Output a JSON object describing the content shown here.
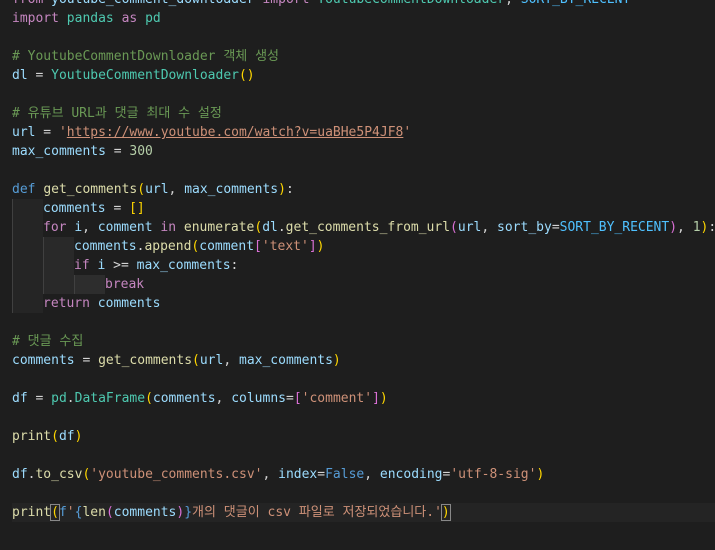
{
  "editor": {
    "colors": {
      "background": "#1e1e1e",
      "keyword": "#c586c0",
      "storage": "#569cd6",
      "function": "#dcdcaa",
      "class": "#4ec9b0",
      "variable": "#9cdcfe",
      "string": "#ce9178",
      "number": "#b5cea8",
      "constant": "#4fc1ff",
      "comment": "#6a9955"
    },
    "lines": [
      {
        "indent": 0,
        "tokens": [
          {
            "t": "from",
            "c": "kw"
          },
          {
            "t": " youtube_comment_downloader ",
            "c": "var"
          },
          {
            "t": "import",
            "c": "kw"
          },
          {
            "t": " ",
            "c": "op"
          },
          {
            "t": "YoutubeCommentDownloader",
            "c": "cls"
          },
          {
            "t": ", ",
            "c": "op"
          },
          {
            "t": "SORT_BY_RECENT",
            "c": "const"
          }
        ]
      },
      {
        "indent": 0,
        "tokens": [
          {
            "t": "import",
            "c": "kw"
          },
          {
            "t": " pandas ",
            "c": "cls"
          },
          {
            "t": "as",
            "c": "kw"
          },
          {
            "t": " pd",
            "c": "cls"
          }
        ]
      },
      {
        "indent": 0,
        "tokens": []
      },
      {
        "indent": 0,
        "tokens": [
          {
            "t": "# YoutubeCommentDownloader 객체 생성",
            "c": "cmt"
          }
        ]
      },
      {
        "indent": 0,
        "tokens": [
          {
            "t": "dl",
            "c": "var"
          },
          {
            "t": " = ",
            "c": "op"
          },
          {
            "t": "YoutubeCommentDownloader",
            "c": "cls"
          },
          {
            "t": "()",
            "c": "br1"
          }
        ]
      },
      {
        "indent": 0,
        "tokens": []
      },
      {
        "indent": 0,
        "tokens": [
          {
            "t": "# 유튜브 URL과 댓글 최대 수 설정",
            "c": "cmt"
          }
        ]
      },
      {
        "indent": 0,
        "tokens": [
          {
            "t": "url",
            "c": "var"
          },
          {
            "t": " = ",
            "c": "op"
          },
          {
            "t": "'",
            "c": "str"
          },
          {
            "t": "https://www.youtube.com/watch?v=uaBHe5P4JF8",
            "c": "str url"
          },
          {
            "t": "'",
            "c": "str"
          }
        ]
      },
      {
        "indent": 0,
        "tokens": [
          {
            "t": "max_comments",
            "c": "var"
          },
          {
            "t": " = ",
            "c": "op"
          },
          {
            "t": "300",
            "c": "num"
          }
        ]
      },
      {
        "indent": 0,
        "tokens": []
      },
      {
        "indent": 0,
        "tokens": [
          {
            "t": "def",
            "c": "def"
          },
          {
            "t": " ",
            "c": "op"
          },
          {
            "t": "get_comments",
            "c": "fn"
          },
          {
            "t": "(",
            "c": "br1"
          },
          {
            "t": "url",
            "c": "var"
          },
          {
            "t": ", ",
            "c": "op"
          },
          {
            "t": "max_comments",
            "c": "var"
          },
          {
            "t": ")",
            "c": "br1"
          },
          {
            "t": ":",
            "c": "op"
          }
        ]
      },
      {
        "indent": 1,
        "tokens": [
          {
            "t": "comments",
            "c": "var"
          },
          {
            "t": " = ",
            "c": "op"
          },
          {
            "t": "[]",
            "c": "br1"
          }
        ]
      },
      {
        "indent": 1,
        "tokens": [
          {
            "t": "for",
            "c": "kw"
          },
          {
            "t": " ",
            "c": "op"
          },
          {
            "t": "i",
            "c": "var"
          },
          {
            "t": ", ",
            "c": "op"
          },
          {
            "t": "comment",
            "c": "var"
          },
          {
            "t": " ",
            "c": "op"
          },
          {
            "t": "in",
            "c": "kw"
          },
          {
            "t": " ",
            "c": "op"
          },
          {
            "t": "enumerate",
            "c": "fn"
          },
          {
            "t": "(",
            "c": "br1"
          },
          {
            "t": "dl",
            "c": "var"
          },
          {
            "t": ".",
            "c": "op"
          },
          {
            "t": "get_comments_from_url",
            "c": "fn"
          },
          {
            "t": "(",
            "c": "br2"
          },
          {
            "t": "url",
            "c": "var"
          },
          {
            "t": ", ",
            "c": "op"
          },
          {
            "t": "sort_by",
            "c": "var"
          },
          {
            "t": "=",
            "c": "op"
          },
          {
            "t": "SORT_BY_RECENT",
            "c": "const"
          },
          {
            "t": ")",
            "c": "br2"
          },
          {
            "t": ", ",
            "c": "op"
          },
          {
            "t": "1",
            "c": "num"
          },
          {
            "t": ")",
            "c": "br1"
          },
          {
            "t": ":",
            "c": "op"
          }
        ]
      },
      {
        "indent": 2,
        "tokens": [
          {
            "t": "comments",
            "c": "var"
          },
          {
            "t": ".",
            "c": "op"
          },
          {
            "t": "append",
            "c": "fn"
          },
          {
            "t": "(",
            "c": "br1"
          },
          {
            "t": "comment",
            "c": "var"
          },
          {
            "t": "[",
            "c": "br2"
          },
          {
            "t": "'text'",
            "c": "str"
          },
          {
            "t": "]",
            "c": "br2"
          },
          {
            "t": ")",
            "c": "br1"
          }
        ]
      },
      {
        "indent": 2,
        "tokens": [
          {
            "t": "if",
            "c": "kw"
          },
          {
            "t": " ",
            "c": "op"
          },
          {
            "t": "i",
            "c": "var"
          },
          {
            "t": " >= ",
            "c": "op"
          },
          {
            "t": "max_comments",
            "c": "var"
          },
          {
            "t": ":",
            "c": "op"
          }
        ]
      },
      {
        "indent": 3,
        "tokens": [
          {
            "t": "break",
            "c": "kw"
          }
        ]
      },
      {
        "indent": 1,
        "tokens": [
          {
            "t": "return",
            "c": "kw"
          },
          {
            "t": " ",
            "c": "op"
          },
          {
            "t": "comments",
            "c": "var"
          }
        ]
      },
      {
        "indent": 0,
        "tokens": []
      },
      {
        "indent": 0,
        "tokens": [
          {
            "t": "# 댓글 수집",
            "c": "cmt"
          }
        ]
      },
      {
        "indent": 0,
        "tokens": [
          {
            "t": "comments",
            "c": "var"
          },
          {
            "t": " = ",
            "c": "op"
          },
          {
            "t": "get_comments",
            "c": "fn"
          },
          {
            "t": "(",
            "c": "br1"
          },
          {
            "t": "url",
            "c": "var"
          },
          {
            "t": ", ",
            "c": "op"
          },
          {
            "t": "max_comments",
            "c": "var"
          },
          {
            "t": ")",
            "c": "br1"
          }
        ]
      },
      {
        "indent": 0,
        "tokens": []
      },
      {
        "indent": 0,
        "tokens": [
          {
            "t": "df",
            "c": "var"
          },
          {
            "t": " = ",
            "c": "op"
          },
          {
            "t": "pd",
            "c": "cls"
          },
          {
            "t": ".",
            "c": "op"
          },
          {
            "t": "DataFrame",
            "c": "cls"
          },
          {
            "t": "(",
            "c": "br1"
          },
          {
            "t": "comments",
            "c": "var"
          },
          {
            "t": ", ",
            "c": "op"
          },
          {
            "t": "columns",
            "c": "var"
          },
          {
            "t": "=",
            "c": "op"
          },
          {
            "t": "[",
            "c": "br2"
          },
          {
            "t": "'comment'",
            "c": "str"
          },
          {
            "t": "]",
            "c": "br2"
          },
          {
            "t": ")",
            "c": "br1"
          }
        ]
      },
      {
        "indent": 0,
        "tokens": []
      },
      {
        "indent": 0,
        "tokens": [
          {
            "t": "print",
            "c": "fn"
          },
          {
            "t": "(",
            "c": "br1"
          },
          {
            "t": "df",
            "c": "var"
          },
          {
            "t": ")",
            "c": "br1"
          }
        ]
      },
      {
        "indent": 0,
        "tokens": []
      },
      {
        "indent": 0,
        "tokens": [
          {
            "t": "df",
            "c": "var"
          },
          {
            "t": ".",
            "c": "op"
          },
          {
            "t": "to_csv",
            "c": "fn"
          },
          {
            "t": "(",
            "c": "br1"
          },
          {
            "t": "'youtube_comments.csv'",
            "c": "str"
          },
          {
            "t": ", ",
            "c": "op"
          },
          {
            "t": "index",
            "c": "var"
          },
          {
            "t": "=",
            "c": "op"
          },
          {
            "t": "False",
            "c": "bool"
          },
          {
            "t": ", ",
            "c": "op"
          },
          {
            "t": "encoding",
            "c": "var"
          },
          {
            "t": "=",
            "c": "op"
          },
          {
            "t": "'utf-8-sig'",
            "c": "str"
          },
          {
            "t": ")",
            "c": "br1"
          }
        ]
      },
      {
        "indent": 0,
        "tokens": []
      },
      {
        "indent": 0,
        "cursor": true,
        "tokens": [
          {
            "t": "print",
            "c": "fn"
          },
          {
            "t": "(",
            "c": "br1 match"
          },
          {
            "t": "f",
            "c": "def"
          },
          {
            "t": "'",
            "c": "str"
          },
          {
            "t": "{",
            "c": "def"
          },
          {
            "t": "len",
            "c": "fn"
          },
          {
            "t": "(",
            "c": "br2"
          },
          {
            "t": "comments",
            "c": "var"
          },
          {
            "t": ")",
            "c": "br2"
          },
          {
            "t": "}",
            "c": "def"
          },
          {
            "t": "개의 댓글이 csv 파일로 저장되었습니다.",
            "c": "str"
          },
          {
            "t": "'",
            "c": "str"
          },
          {
            "t": ")",
            "c": "br1 match"
          }
        ]
      }
    ]
  }
}
